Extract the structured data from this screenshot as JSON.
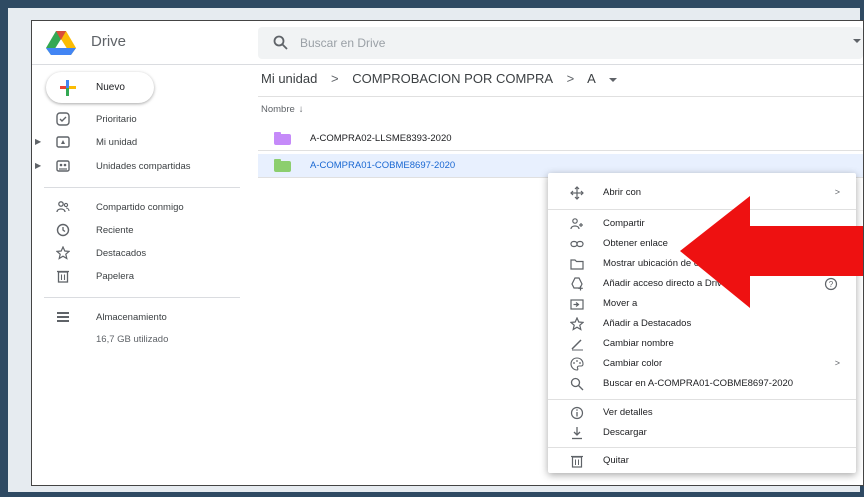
{
  "app": {
    "brand": "Drive"
  },
  "search": {
    "placeholder": "Buscar en Drive"
  },
  "new_button": {
    "label": "Nuevo"
  },
  "sidebar": {
    "items": [
      {
        "label": "Prioritario",
        "icon": "check-circle-icon"
      },
      {
        "label": "Mi unidad",
        "icon": "drive-icon"
      },
      {
        "label": "Unidades compartidas",
        "icon": "shared-drives-icon"
      },
      {
        "label": "Compartido conmigo",
        "icon": "people-icon"
      },
      {
        "label": "Reciente",
        "icon": "clock-icon"
      },
      {
        "label": "Destacados",
        "icon": "star-icon"
      },
      {
        "label": "Papelera",
        "icon": "trash-icon"
      },
      {
        "label": "Almacenamiento",
        "icon": "storage-icon"
      }
    ],
    "storage_used": "16,7 GB utilizado"
  },
  "breadcrumb": {
    "items": [
      "Mi unidad",
      "COMPROBACION POR COMPRA",
      "A"
    ],
    "separator": ">"
  },
  "list": {
    "sort_column": "Nombre",
    "sort_arrow": "↓",
    "rows": [
      {
        "name": "A-COMPRA02-LLSME8393-2020",
        "folder_color": "#c58af9",
        "selected": false
      },
      {
        "name": "A-COMPRA01-COBME8697-2020",
        "folder_color": "#8cce6e",
        "selected": true
      }
    ]
  },
  "context_menu": {
    "items": [
      {
        "label": "Abrir con",
        "icon": "open-with-icon",
        "submenu": true
      },
      {
        "label": "Compartir",
        "icon": "share-icon"
      },
      {
        "label": "Obtener enlace",
        "icon": "link-icon"
      },
      {
        "label": "Mostrar ubicación de carpeta",
        "icon": "folder-outline-icon"
      },
      {
        "label": "Añadir acceso directo a Drive",
        "icon": "add-shortcut-icon",
        "help": true
      },
      {
        "label": "Mover a",
        "icon": "move-icon"
      },
      {
        "label": "Añadir a Destacados",
        "icon": "star-icon"
      },
      {
        "label": "Cambiar nombre",
        "icon": "rename-icon"
      },
      {
        "label": "Cambiar color",
        "icon": "palette-icon",
        "submenu": true
      },
      {
        "label": "Buscar en A-COMPRA01-COBME8697-2020",
        "icon": "search-icon"
      },
      {
        "label": "Ver detalles",
        "icon": "info-icon"
      },
      {
        "label": "Descargar",
        "icon": "download-icon"
      },
      {
        "label": "Quitar",
        "icon": "trash-icon"
      }
    ],
    "submenu_chevron": ">"
  },
  "colors": {
    "accent_blue": "#1967d2",
    "selected_row_bg": "#e8f0fe",
    "annotation_arrow": "#ee1111",
    "outer_background": "#2f4a63"
  }
}
